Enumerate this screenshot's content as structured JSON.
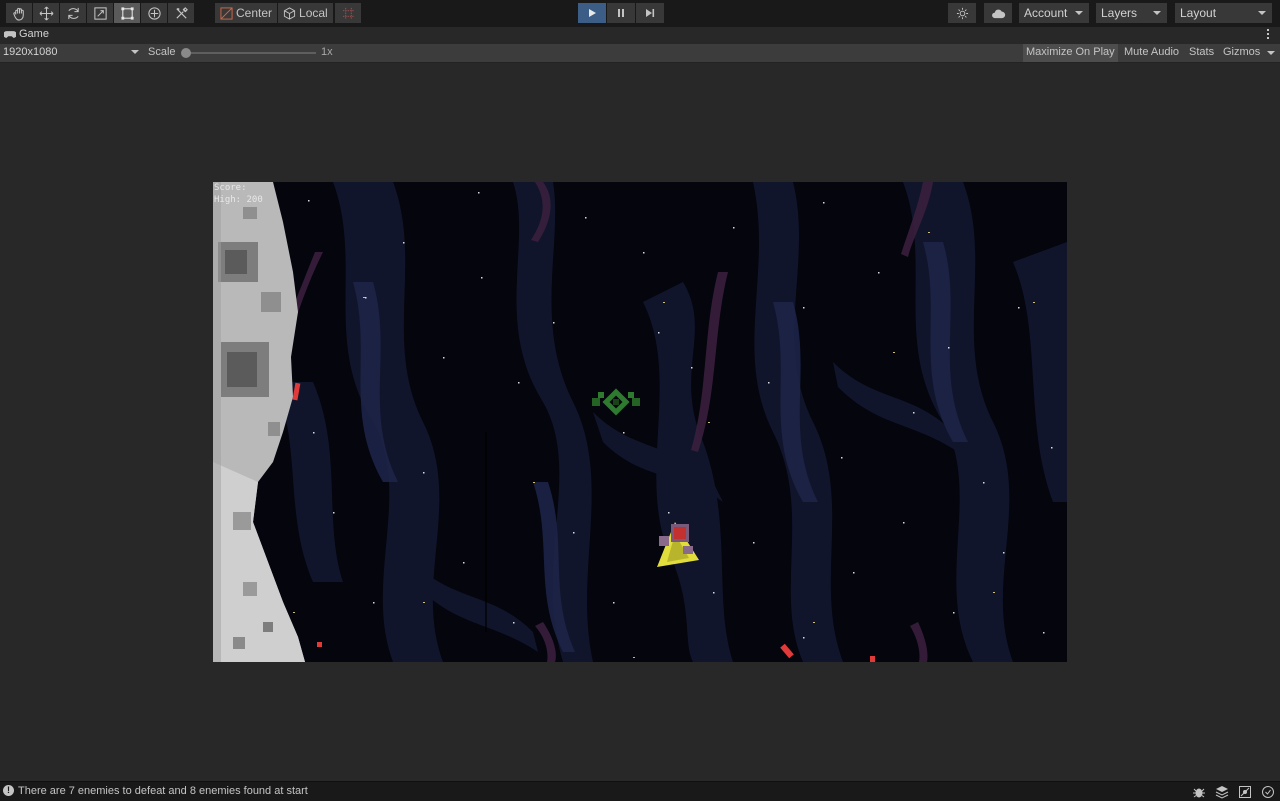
{
  "toolbar": {
    "tools": [
      "hand-tool",
      "move-tool",
      "rotate-tool",
      "scale-tool",
      "rect-tool",
      "transform-tool",
      "custom-tool"
    ],
    "active_tool": "rect-tool",
    "pivot_label": "Center",
    "space_label": "Local",
    "account_label": "Account",
    "layers_label": "Layers",
    "layout_label": "Layout"
  },
  "game_tab": {
    "label": "Game"
  },
  "game_bar": {
    "resolution": "1920x1080",
    "scale_label": "Scale",
    "scale_value": "1x",
    "scale_fraction": 0.0,
    "maximize_label": "Maximize On Play",
    "mute_label": "Mute Audio",
    "stats_label": "Stats",
    "gizmos_label": "Gizmos"
  },
  "game": {
    "score_label": "Score:",
    "high_label": "High: 200"
  },
  "status": {
    "message": "There are 7 enemies to defeat and 8 enemies found at start"
  },
  "colors": {
    "play_active": "#3b5d86",
    "toolbar_bg": "#191919",
    "button_bg": "#383838"
  }
}
